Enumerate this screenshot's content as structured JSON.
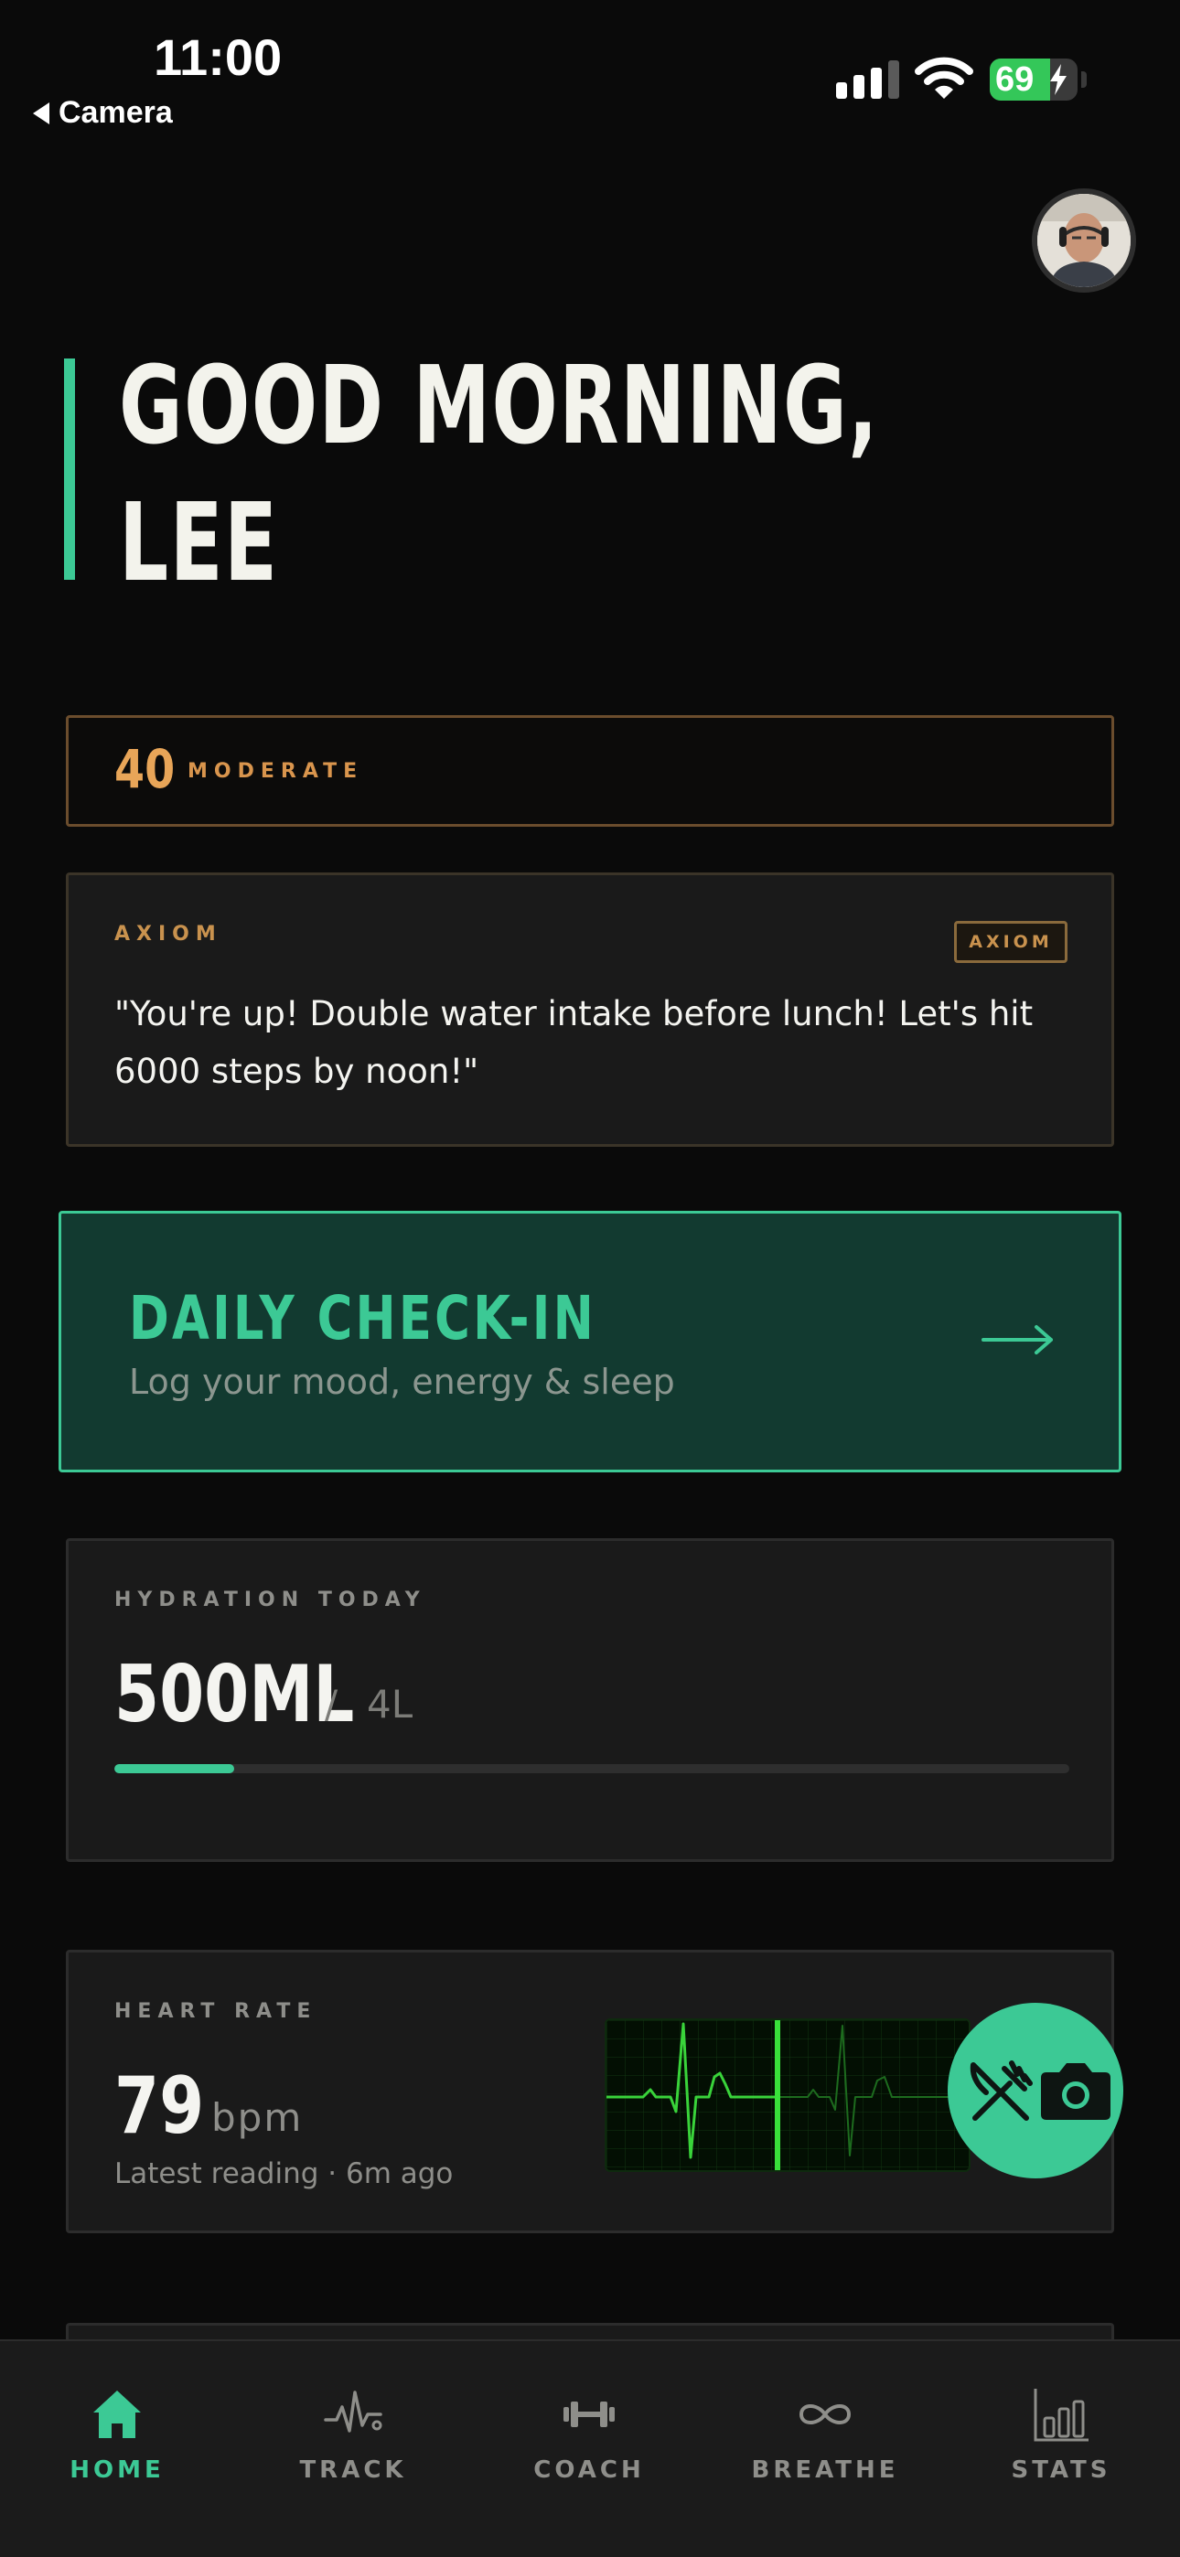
{
  "status_bar": {
    "time": "11:00",
    "back_label": "Camera",
    "battery": "69",
    "battery_level": 0.69
  },
  "profile": {
    "avatar_icon": "user-avatar"
  },
  "greeting": {
    "line1": "GOOD MORNING,",
    "line2": "LEE"
  },
  "readiness": {
    "score": "40",
    "label": "MODERATE"
  },
  "axiom": {
    "title": "AXIOM",
    "badge": "AXIOM",
    "message": "\"You're up! Double water intake before lunch! Let's hit 6000 steps by noon!\""
  },
  "checkin": {
    "title": "DAILY CHECK-IN",
    "subtitle": "Log your mood, energy & sleep",
    "arrow_icon": "arrow-right-icon"
  },
  "hydration": {
    "label": "HYDRATION TODAY",
    "value": "500ML",
    "separator": "/",
    "goal": "4L",
    "progress": 0.125
  },
  "heart_rate": {
    "label": "HEART RATE",
    "value": "79",
    "unit": "bpm",
    "subtitle": "Latest reading · 6m ago"
  },
  "fab": {
    "icons": [
      "fork-knife-icon",
      "camera-icon"
    ]
  },
  "tabs": [
    {
      "label": "HOME",
      "icon": "home-icon",
      "active": true
    },
    {
      "label": "TRACK",
      "icon": "pulse-icon",
      "active": false
    },
    {
      "label": "COACH",
      "icon": "dumbbell-icon",
      "active": false
    },
    {
      "label": "BREATHE",
      "icon": "infinity-icon",
      "active": false
    },
    {
      "label": "STATS",
      "icon": "bar-chart-icon",
      "active": false
    }
  ],
  "colors": {
    "accent": "#3cc995",
    "warning": "#e8a558",
    "background": "#0a0a0a",
    "card": "#1a1a1a"
  }
}
